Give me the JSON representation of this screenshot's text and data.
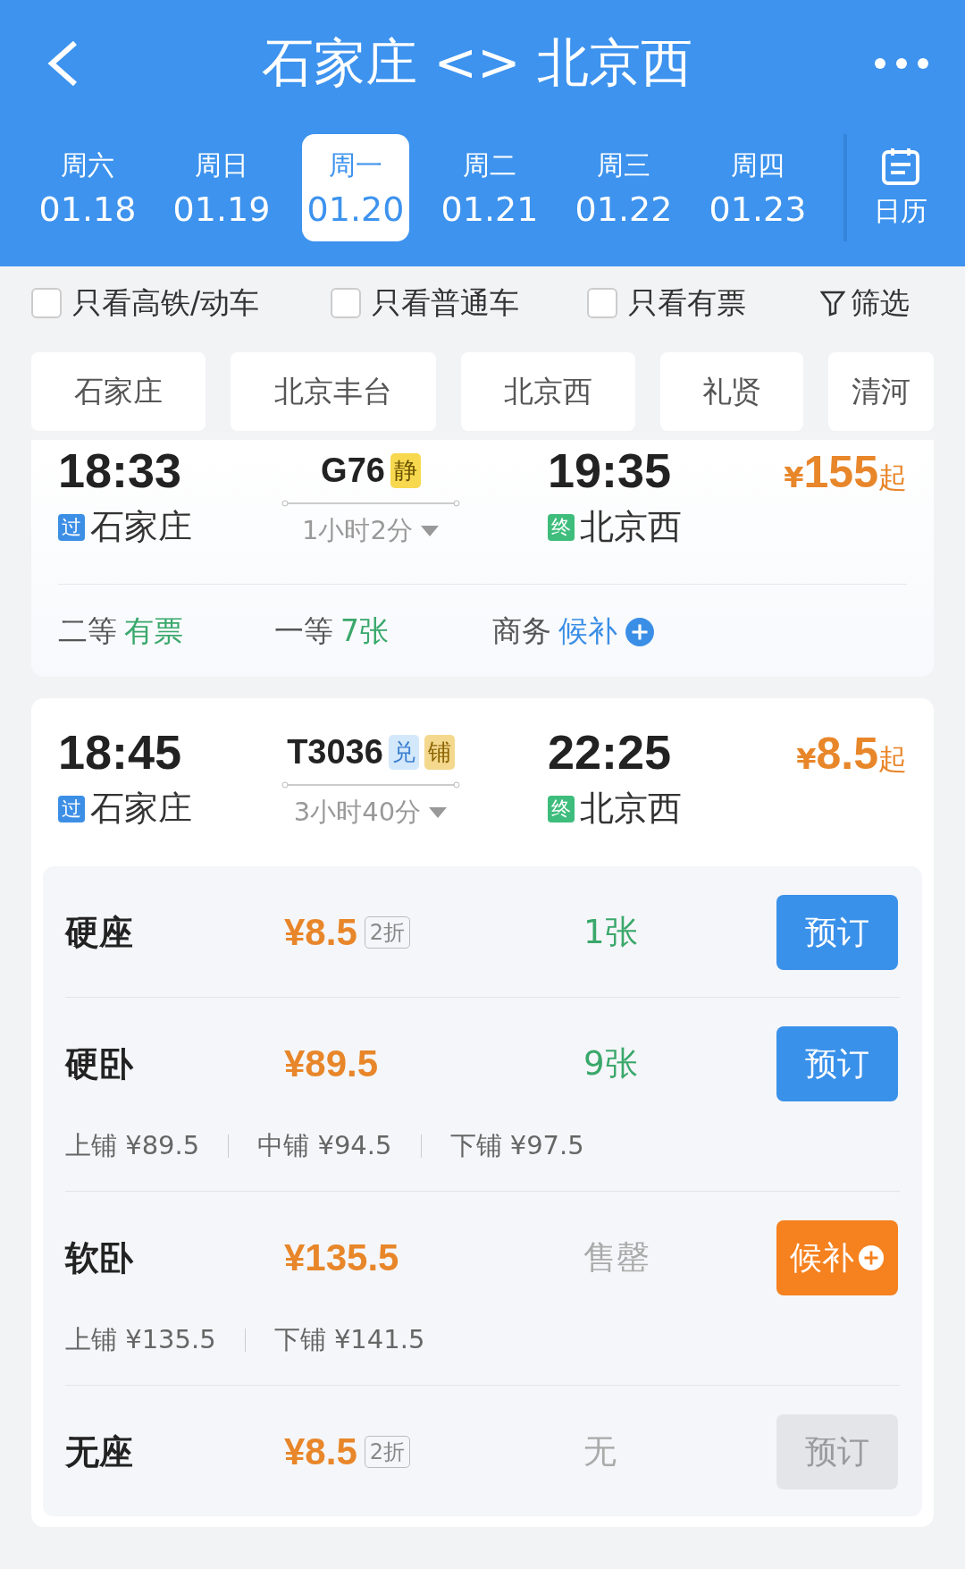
{
  "header": {
    "title": "石家庄 <> 北京西"
  },
  "dates": [
    {
      "weekday": "周六",
      "date": "01.18",
      "selected": false
    },
    {
      "weekday": "周日",
      "date": "01.19",
      "selected": false
    },
    {
      "weekday": "周一",
      "date": "01.20",
      "selected": true
    },
    {
      "weekday": "周二",
      "date": "01.21",
      "selected": false
    },
    {
      "weekday": "周三",
      "date": "01.22",
      "selected": false
    },
    {
      "weekday": "周四",
      "date": "01.23",
      "selected": false
    }
  ],
  "calendar": {
    "label": "日历"
  },
  "filters": [
    {
      "label": "只看高铁/动车",
      "checked": false
    },
    {
      "label": "只看普通车",
      "checked": false
    },
    {
      "label": "只看有票",
      "checked": false
    }
  ],
  "filter_button": {
    "label": "筛选"
  },
  "stations": [
    {
      "label": "石家庄"
    },
    {
      "label": "北京丰台"
    },
    {
      "label": "北京西"
    },
    {
      "label": "礼贤"
    },
    {
      "label": "清河"
    }
  ],
  "trains": [
    {
      "depart_time": "18:33",
      "depart_tag": "过",
      "depart_station": "石家庄",
      "number": "G76",
      "badges": [
        {
          "text": "静",
          "kind": "quiet"
        }
      ],
      "duration": "1小时2分",
      "arrive_time": "19:35",
      "arrive_tag": "终",
      "arrive_station": "北京西",
      "currency": "¥",
      "price": "155",
      "price_suffix": "起",
      "seat_summary": [
        {
          "class": "二等",
          "availability": "有票",
          "kind": "available"
        },
        {
          "class": "一等",
          "availability": "7张",
          "kind": "available"
        },
        {
          "class": "商务",
          "availability": "候补",
          "kind": "waitlist"
        }
      ]
    },
    {
      "depart_time": "18:45",
      "depart_tag": "过",
      "depart_station": "石家庄",
      "number": "T3036",
      "badges": [
        {
          "text": "兑",
          "kind": "exchange"
        },
        {
          "text": "铺",
          "kind": "berth"
        }
      ],
      "duration": "3小时40分",
      "arrive_time": "22:25",
      "arrive_tag": "终",
      "arrive_station": "北京西",
      "currency": "¥",
      "price": "8.5",
      "price_suffix": "起",
      "seats": [
        {
          "name": "硬座",
          "price": "¥8.5",
          "discount": "2折",
          "availability": "1张",
          "kind": "available",
          "button": {
            "label": "预订",
            "kind": "book",
            "disabled": false
          }
        },
        {
          "name": "硬卧",
          "price": "¥89.5",
          "availability": "9张",
          "kind": "available",
          "button": {
            "label": "预订",
            "kind": "book",
            "disabled": false
          },
          "berths": [
            "上铺 ¥89.5",
            "中铺 ¥94.5",
            "下铺 ¥97.5"
          ]
        },
        {
          "name": "软卧",
          "price": "¥135.5",
          "availability": "售罄",
          "kind": "sold_out",
          "button": {
            "label": "候补",
            "kind": "waitlist",
            "disabled": false
          },
          "berths": [
            "上铺 ¥135.5",
            "下铺 ¥141.5"
          ]
        },
        {
          "name": "无座",
          "price": "¥8.5",
          "discount": "2折",
          "availability": "无",
          "kind": "none",
          "button": {
            "label": "预订",
            "kind": "book",
            "disabled": true
          }
        }
      ]
    }
  ]
}
